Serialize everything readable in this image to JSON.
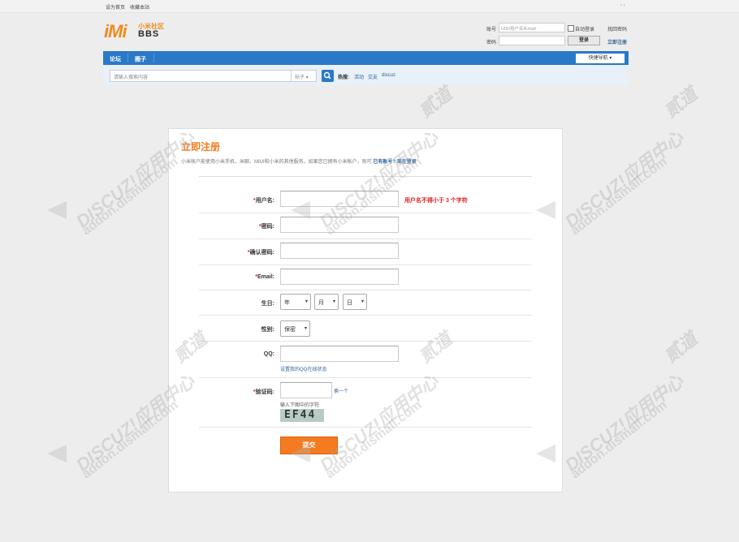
{
  "topbar": {
    "set_home": "设为首页",
    "bookmark": "收藏本站",
    "toggle": "‹ ›"
  },
  "logo": {
    "main": "iMi",
    "sub": "小米社区",
    "bbs": "BBS"
  },
  "login": {
    "account_label": "账号",
    "account_placeholder": "UID/用户名/Email",
    "auto_login": "自动登录",
    "find_password": "找回密码",
    "password_label": "密码",
    "login_button": "登录",
    "register_link": "立即注册"
  },
  "nav": {
    "items": [
      "论坛",
      "圈子"
    ],
    "quick_nav": "快捷导航 ▾"
  },
  "search": {
    "placeholder": "请输入搜索内容",
    "type": "帖子 ▾",
    "hot_label": "热搜:",
    "hot_items": [
      "活动",
      "交友",
      "discuz"
    ]
  },
  "register": {
    "title": "立即注册",
    "desc": "小米帐户能使用小米手机、米聊、MIUI和小米的其他服务。如果您已拥有小米帐户，则可",
    "has_account": "已有账号?",
    "login_now": "现在登录",
    "fields": {
      "username": {
        "label": "用户名:",
        "hint": "用户名不得小于 3 个字符"
      },
      "password": {
        "label": "密码:"
      },
      "confirm_password": {
        "label": "确认密码:"
      },
      "email": {
        "label": "Email:"
      },
      "birthday": {
        "label": "生日:",
        "year": "年",
        "month": "月",
        "day": "日"
      },
      "gender": {
        "label": "性别:",
        "value": "保密"
      },
      "qq": {
        "label": "QQ:",
        "link": "设置我的QQ在线状态"
      },
      "captcha": {
        "label": "验证码:",
        "refresh": "换一个",
        "hint": "输入下图中的字符",
        "image_text": "EF44"
      }
    },
    "required_mark": "*",
    "submit": "提交"
  },
  "watermark": {
    "text": "DISCUZ!应用中心",
    "url": "addon.dismall.com",
    "brand": "贰道"
  },
  "colors": {
    "brand_orange": "#f47b20",
    "nav_blue": "#2a78c8",
    "required_red": "#e02020"
  }
}
